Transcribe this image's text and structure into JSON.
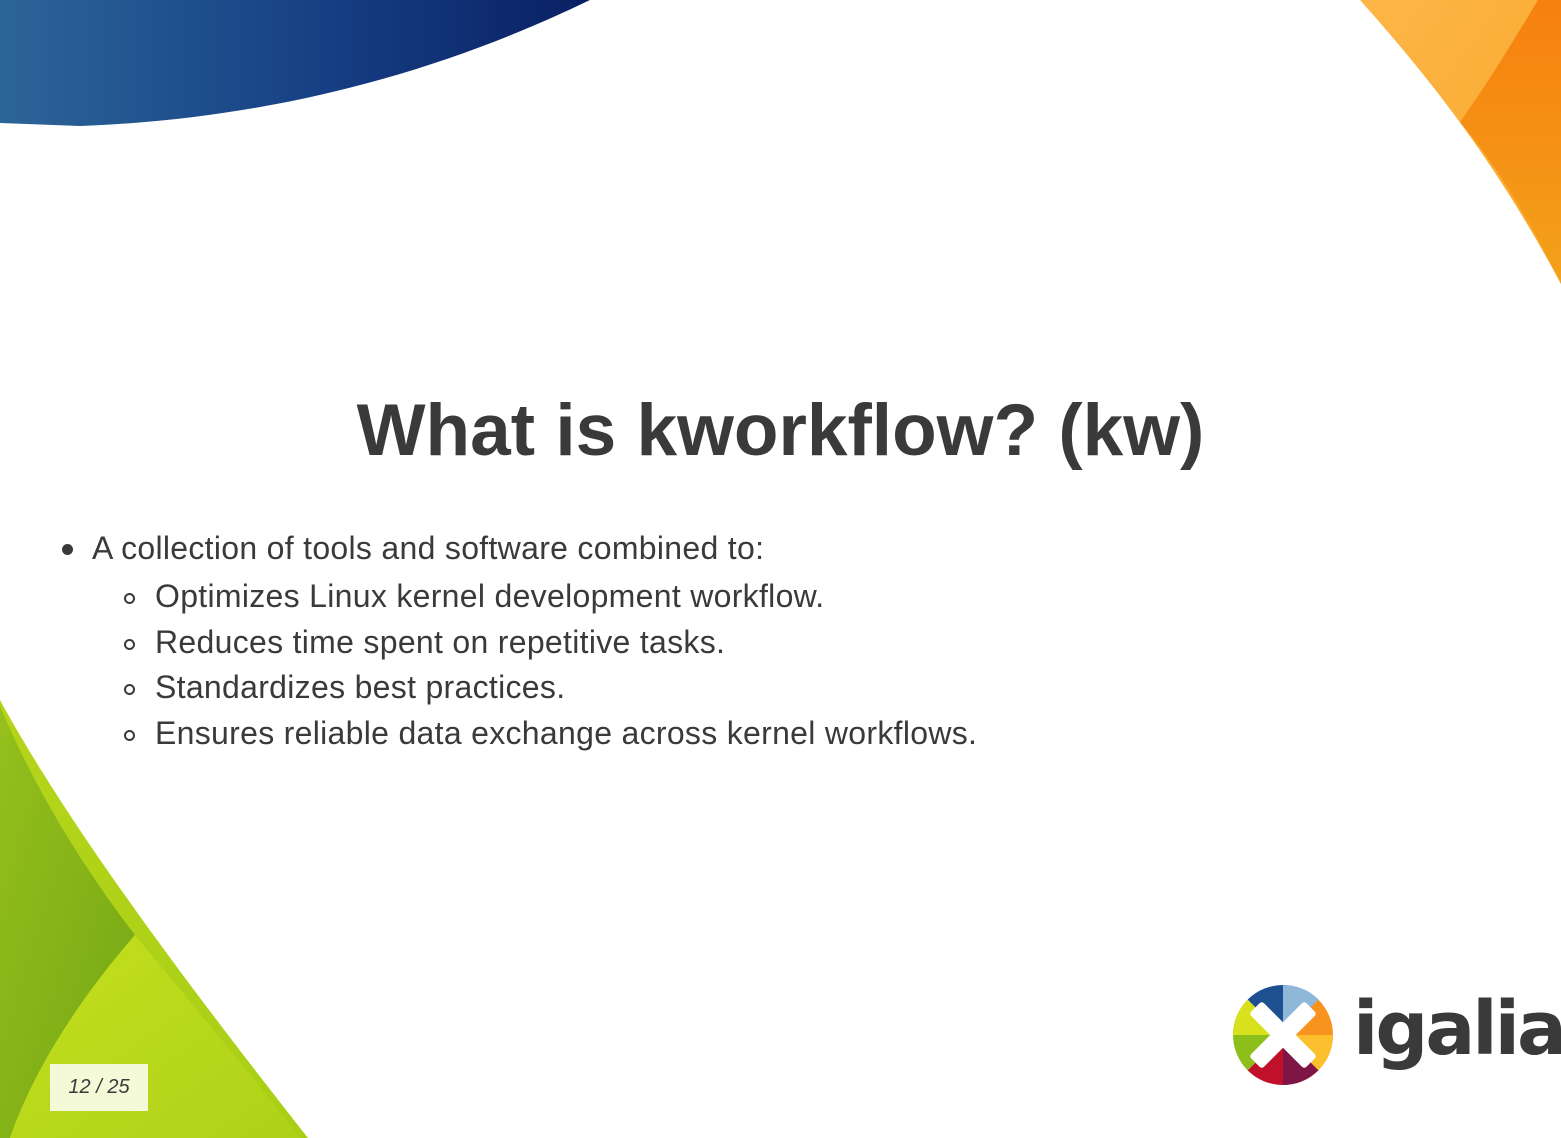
{
  "slide": {
    "title": "What is kworkflow? (kw)",
    "bullet": "A collection of tools and software combined to:",
    "sub_items": [
      "Optimizes Linux kernel development workflow.",
      "Reduces time spent on repetitive tasks.",
      "Standardizes best practices.",
      "Ensures reliable data exchange across kernel workflows."
    ]
  },
  "page_counter": "12 / 25",
  "logo": {
    "text": "igalia",
    "icon": "igalia-logo-mark-icon"
  },
  "colors": {
    "text": "#3a3a3a",
    "corner_blue": "#0b2468",
    "corner_orange": "#f7931e",
    "corner_green": "#9cc31b",
    "counter_background": "#f4f9d8"
  }
}
